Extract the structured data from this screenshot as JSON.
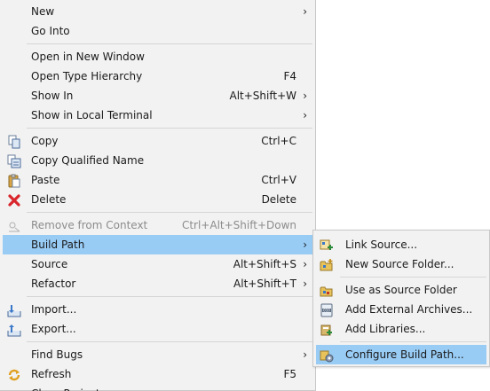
{
  "main_menu": {
    "new": "New",
    "go_into": "Go Into",
    "open_new_window": "Open in New Window",
    "open_type_hierarchy": "Open Type Hierarchy",
    "open_type_hierarchy_sc": "F4",
    "show_in": "Show In",
    "show_in_sc": "Alt+Shift+W",
    "show_local_terminal": "Show in Local Terminal",
    "copy": "Copy",
    "copy_sc": "Ctrl+C",
    "copy_qualified": "Copy Qualified Name",
    "paste": "Paste",
    "paste_sc": "Ctrl+V",
    "delete": "Delete",
    "delete_sc": "Delete",
    "remove_context": "Remove from Context",
    "remove_context_sc": "Ctrl+Alt+Shift+Down",
    "build_path": "Build Path",
    "source": "Source",
    "source_sc": "Alt+Shift+S",
    "refactor": "Refactor",
    "refactor_sc": "Alt+Shift+T",
    "import": "Import...",
    "export": "Export...",
    "find_bugs": "Find Bugs",
    "refresh": "Refresh",
    "refresh_sc": "F5",
    "close_project": "Close Project"
  },
  "submenu_arrow": "›",
  "build_path_submenu": {
    "link_source": "Link Source...",
    "new_source_folder": "New Source Folder...",
    "use_as_source": "Use as Source Folder",
    "add_external_archives": "Add External Archives...",
    "add_libraries": "Add Libraries...",
    "configure_build_path": "Configure Build Path..."
  },
  "colors": {
    "menu_bg": "#f2f2f2",
    "selection": "#99ccf5",
    "separator": "#d6d6d6",
    "disabled_text": "#8c8c8c"
  }
}
